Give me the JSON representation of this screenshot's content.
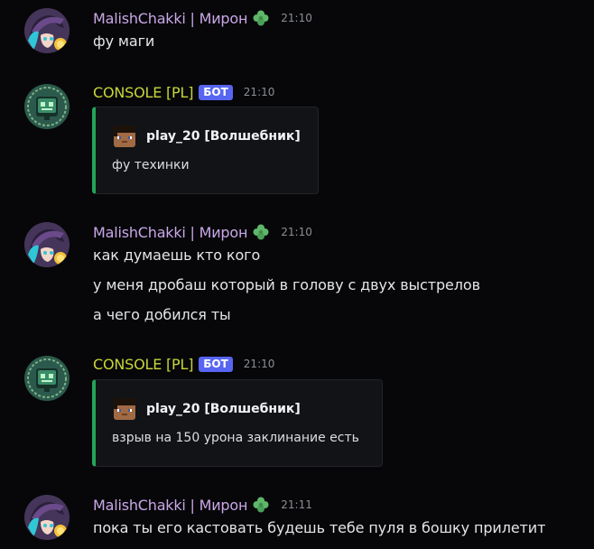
{
  "colors": {
    "background": "#070709",
    "user_name": "#c9a7e8",
    "bot_name": "#c7d63a",
    "bot_tag": "#5865f2",
    "embed_accent": "#23a559",
    "timestamp": "#8a8e94"
  },
  "messages": [
    {
      "author": "MalishChakki | Мирон",
      "time": "21:10",
      "avatar": "witch-avatar",
      "badge_icon": "clover-icon",
      "lines": [
        "фу маги"
      ]
    },
    {
      "author": "CONSOLE [PL]",
      "bot_tag": "БОТ",
      "time": "21:10",
      "avatar": "console-bot-avatar",
      "embed": {
        "author": "play_20 [Волшебник]",
        "author_icon": "skin-head-icon",
        "description": "фу техинки"
      }
    },
    {
      "author": "MalishChakki | Мирон",
      "time": "21:10",
      "avatar": "witch-avatar",
      "badge_icon": "clover-icon",
      "lines": [
        "как думаешь кто кого",
        "у меня дробаш который в голову с двух выстрелов",
        "а чего добился ты"
      ]
    },
    {
      "author": "CONSOLE [PL]",
      "bot_tag": "БОТ",
      "time": "21:10",
      "avatar": "console-bot-avatar",
      "embed": {
        "author": "play_20 [Волшебник]",
        "author_icon": "skin-head-icon",
        "description": "взрыв на 150 урона заклинание есть"
      }
    },
    {
      "author": "MalishChakki | Мирон",
      "time": "21:11",
      "avatar": "witch-avatar",
      "badge_icon": "clover-icon",
      "lines": [
        "пока ты его кастовать будешь тебе пуля в бошку прилетит"
      ]
    }
  ]
}
